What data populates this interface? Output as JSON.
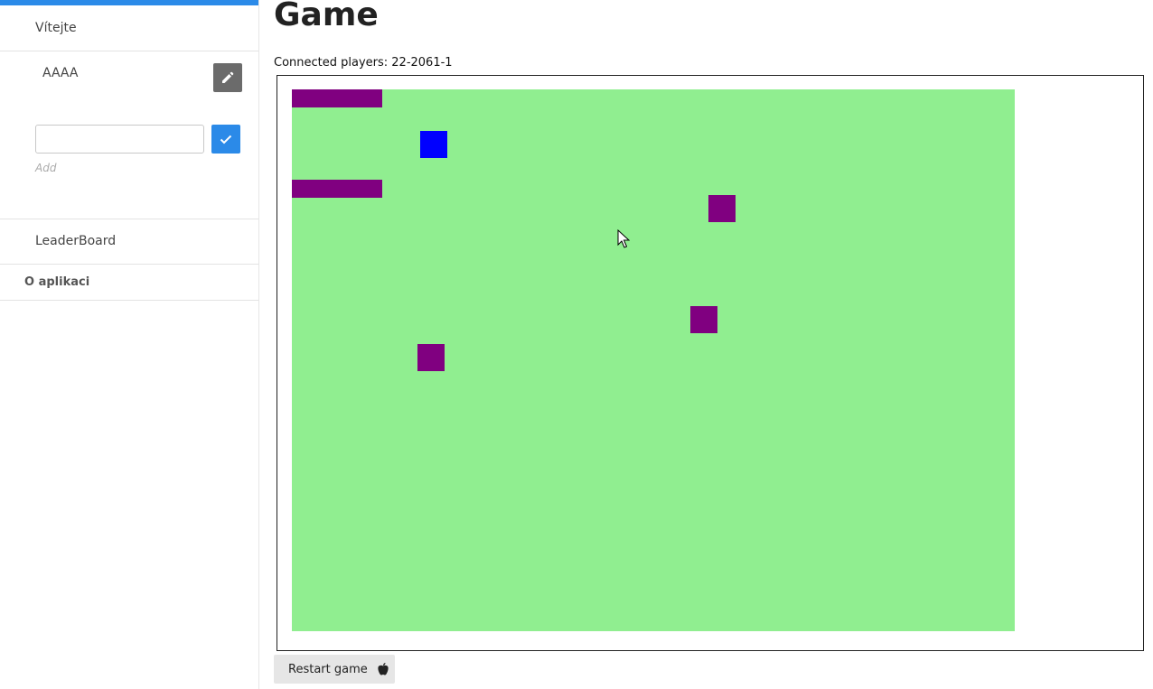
{
  "sidebar": {
    "welcome_label": "Vítejte",
    "user_name": "AAAA",
    "edit_icon": "pencil-icon",
    "add_input_value": "",
    "confirm_icon": "check-icon",
    "add_hint": "Add",
    "leaderboard_label": "LeaderBoard",
    "about_label": "O aplikaci",
    "accent_color": "#2b8ae8"
  },
  "main": {
    "title": "Game",
    "connected_players_label": "Connected players: 22-2061-1",
    "restart_label": "Restart game",
    "restart_icon": "apple-icon"
  },
  "game": {
    "field_color": "#90ee90",
    "player_color": "#0000ff",
    "obstacle_color": "#800080"
  }
}
